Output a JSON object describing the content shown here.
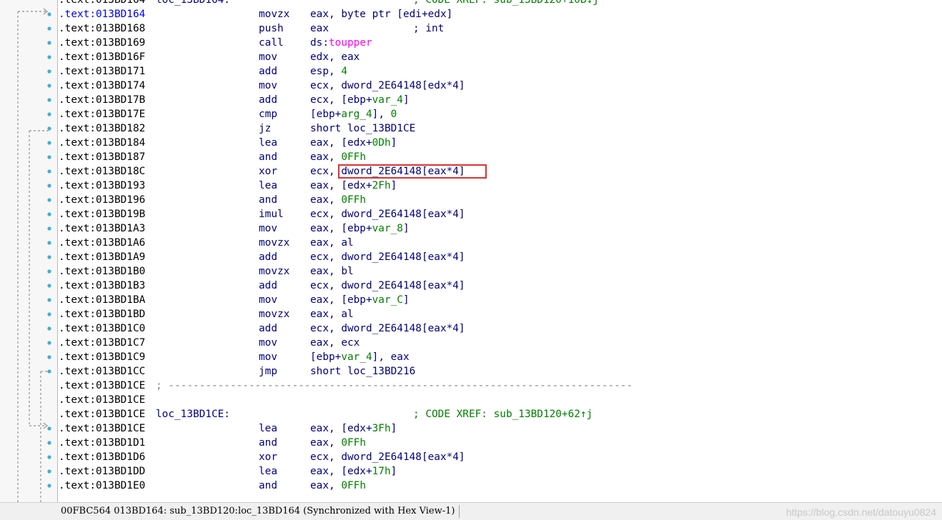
{
  "listing": {
    "lines": [
      {
        "addr": ".text:013BD164",
        "label": "loc_13BD164:",
        "mnem": "",
        "ops": "",
        "comment": "; CODE XREF: sub_13BD120+10B↓j",
        "kind": "label",
        "partial_top": true
      },
      {
        "addr": ".text:013BD164",
        "mnem": "movzx",
        "ops": [
          {
            "t": "eax, byte ptr [edi+edx]",
            "c": "ops"
          }
        ],
        "highlight_addr": true
      },
      {
        "addr": ".text:013BD168",
        "mnem": "push",
        "ops": [
          {
            "t": "eax",
            "c": "ops"
          }
        ],
        "comment_parts": [
          {
            "t": "; ",
            "c": "cmt-int"
          },
          {
            "t": "int",
            "c": "cmt-int"
          }
        ]
      },
      {
        "addr": ".text:013BD169",
        "mnem": "call",
        "ops": [
          {
            "t": "ds:",
            "c": "ops"
          },
          {
            "t": "toupper",
            "c": "op-import"
          }
        ]
      },
      {
        "addr": ".text:013BD16F",
        "mnem": "mov",
        "ops": [
          {
            "t": "edx, eax",
            "c": "ops"
          }
        ]
      },
      {
        "addr": ".text:013BD171",
        "mnem": "add",
        "ops": [
          {
            "t": "esp, ",
            "c": "ops"
          },
          {
            "t": "4",
            "c": "op-num"
          }
        ]
      },
      {
        "addr": ".text:013BD174",
        "mnem": "mov",
        "ops": [
          {
            "t": "ecx, dword_2E64148[edx*4]",
            "c": "ops"
          }
        ]
      },
      {
        "addr": ".text:013BD17B",
        "mnem": "add",
        "ops": [
          {
            "t": "ecx, [ebp+",
            "c": "ops"
          },
          {
            "t": "var_4",
            "c": "op-local"
          },
          {
            "t": "]",
            "c": "ops"
          }
        ]
      },
      {
        "addr": ".text:013BD17E",
        "mnem": "cmp",
        "ops": [
          {
            "t": "[ebp+",
            "c": "ops"
          },
          {
            "t": "arg_4",
            "c": "op-local"
          },
          {
            "t": "], ",
            "c": "ops"
          },
          {
            "t": "0",
            "c": "op-num"
          }
        ]
      },
      {
        "addr": ".text:013BD182",
        "mnem": "jz",
        "ops": [
          {
            "t": "short loc_13BD1CE",
            "c": "ops"
          }
        ]
      },
      {
        "addr": ".text:013BD184",
        "mnem": "lea",
        "ops": [
          {
            "t": "eax, [edx+",
            "c": "ops"
          },
          {
            "t": "0Dh",
            "c": "op-num"
          },
          {
            "t": "]",
            "c": "ops"
          }
        ]
      },
      {
        "addr": ".text:013BD187",
        "mnem": "and",
        "ops": [
          {
            "t": "eax, ",
            "c": "ops"
          },
          {
            "t": "0FFh",
            "c": "op-num"
          }
        ]
      },
      {
        "addr": ".text:013BD18C",
        "mnem": "xor",
        "ops": [
          {
            "t": "ecx, dword_2E64148[eax*4]",
            "c": "ops"
          }
        ]
      },
      {
        "addr": ".text:013BD193",
        "mnem": "lea",
        "ops": [
          {
            "t": "eax, [edx+",
            "c": "ops"
          },
          {
            "t": "2Fh",
            "c": "op-num"
          },
          {
            "t": "]",
            "c": "ops"
          }
        ]
      },
      {
        "addr": ".text:013BD196",
        "mnem": "and",
        "ops": [
          {
            "t": "eax, ",
            "c": "ops"
          },
          {
            "t": "0FFh",
            "c": "op-num"
          }
        ]
      },
      {
        "addr": ".text:013BD19B",
        "mnem": "imul",
        "ops": [
          {
            "t": "ecx, dword_2E64148[eax*4]",
            "c": "ops"
          }
        ]
      },
      {
        "addr": ".text:013BD1A3",
        "mnem": "mov",
        "ops": [
          {
            "t": "eax, [ebp+",
            "c": "ops"
          },
          {
            "t": "var_8",
            "c": "op-local"
          },
          {
            "t": "]",
            "c": "ops"
          }
        ]
      },
      {
        "addr": ".text:013BD1A6",
        "mnem": "movzx",
        "ops": [
          {
            "t": "eax, al",
            "c": "ops"
          }
        ]
      },
      {
        "addr": ".text:013BD1A9",
        "mnem": "add",
        "ops": [
          {
            "t": "ecx, dword_2E64148[eax*4]",
            "c": "ops"
          }
        ]
      },
      {
        "addr": ".text:013BD1B0",
        "mnem": "movzx",
        "ops": [
          {
            "t": "eax, bl",
            "c": "ops"
          }
        ]
      },
      {
        "addr": ".text:013BD1B3",
        "mnem": "add",
        "ops": [
          {
            "t": "ecx, dword_2E64148[eax*4]",
            "c": "ops"
          }
        ]
      },
      {
        "addr": ".text:013BD1BA",
        "mnem": "mov",
        "ops": [
          {
            "t": "eax, [ebp+",
            "c": "ops"
          },
          {
            "t": "var_C",
            "c": "op-local"
          },
          {
            "t": "]",
            "c": "ops"
          }
        ]
      },
      {
        "addr": ".text:013BD1BD",
        "mnem": "movzx",
        "ops": [
          {
            "t": "eax, al",
            "c": "ops"
          }
        ]
      },
      {
        "addr": ".text:013BD1C0",
        "mnem": "add",
        "ops": [
          {
            "t": "ecx, dword_2E64148[eax*4]",
            "c": "ops"
          }
        ]
      },
      {
        "addr": ".text:013BD1C7",
        "mnem": "mov",
        "ops": [
          {
            "t": "eax, ecx",
            "c": "ops"
          }
        ]
      },
      {
        "addr": ".text:013BD1C9",
        "mnem": "mov",
        "ops": [
          {
            "t": "[ebp+",
            "c": "ops"
          },
          {
            "t": "var_4",
            "c": "op-local"
          },
          {
            "t": "], eax",
            "c": "ops"
          }
        ]
      },
      {
        "addr": ".text:013BD1CC",
        "mnem": "jmp",
        "ops": [
          {
            "t": "short loc_13BD216",
            "c": "ops"
          }
        ]
      },
      {
        "addr": ".text:013BD1CE",
        "kind": "separator",
        "separator": "; ---------------------------------------------------------------------------"
      },
      {
        "addr": ".text:013BD1CE",
        "kind": "blank"
      },
      {
        "addr": ".text:013BD1CE",
        "label": "loc_13BD1CE:",
        "comment": "; CODE XREF: sub_13BD120+62↑j",
        "kind": "label"
      },
      {
        "addr": ".text:013BD1CE",
        "mnem": "lea",
        "ops": [
          {
            "t": "eax, [edx+",
            "c": "ops"
          },
          {
            "t": "3Fh",
            "c": "op-num"
          },
          {
            "t": "]",
            "c": "ops"
          }
        ]
      },
      {
        "addr": ".text:013BD1D1",
        "mnem": "and",
        "ops": [
          {
            "t": "eax, ",
            "c": "ops"
          },
          {
            "t": "0FFh",
            "c": "op-num"
          }
        ]
      },
      {
        "addr": ".text:013BD1D6",
        "mnem": "xor",
        "ops": [
          {
            "t": "ecx, dword_2E64148[eax*4]",
            "c": "ops"
          }
        ]
      },
      {
        "addr": ".text:013BD1DD",
        "mnem": "lea",
        "ops": [
          {
            "t": "eax, [edx+",
            "c": "ops"
          },
          {
            "t": "17h",
            "c": "op-num"
          },
          {
            "t": "]",
            "c": "ops"
          }
        ]
      },
      {
        "addr": ".text:013BD1E0",
        "mnem": "and",
        "ops": [
          {
            "t": "eax, ",
            "c": "ops"
          },
          {
            "t": "0FFh",
            "c": "op-num"
          }
        ]
      }
    ]
  },
  "highlight": {
    "text": "dword_2E64148[eax*4]",
    "color": "#e03030"
  },
  "statusbar": {
    "text": "00FBC564 013BD164: sub_13BD120:loc_13BD164 (Synchronized with Hex View-1)"
  },
  "watermark": "https://blog.csdn.net/datouyu0824",
  "colors": {
    "background": "#ffffff",
    "gutter": "#f7f7f7",
    "arrow_dots": "#3ab0d8",
    "arrows": "#a0a0a0"
  }
}
